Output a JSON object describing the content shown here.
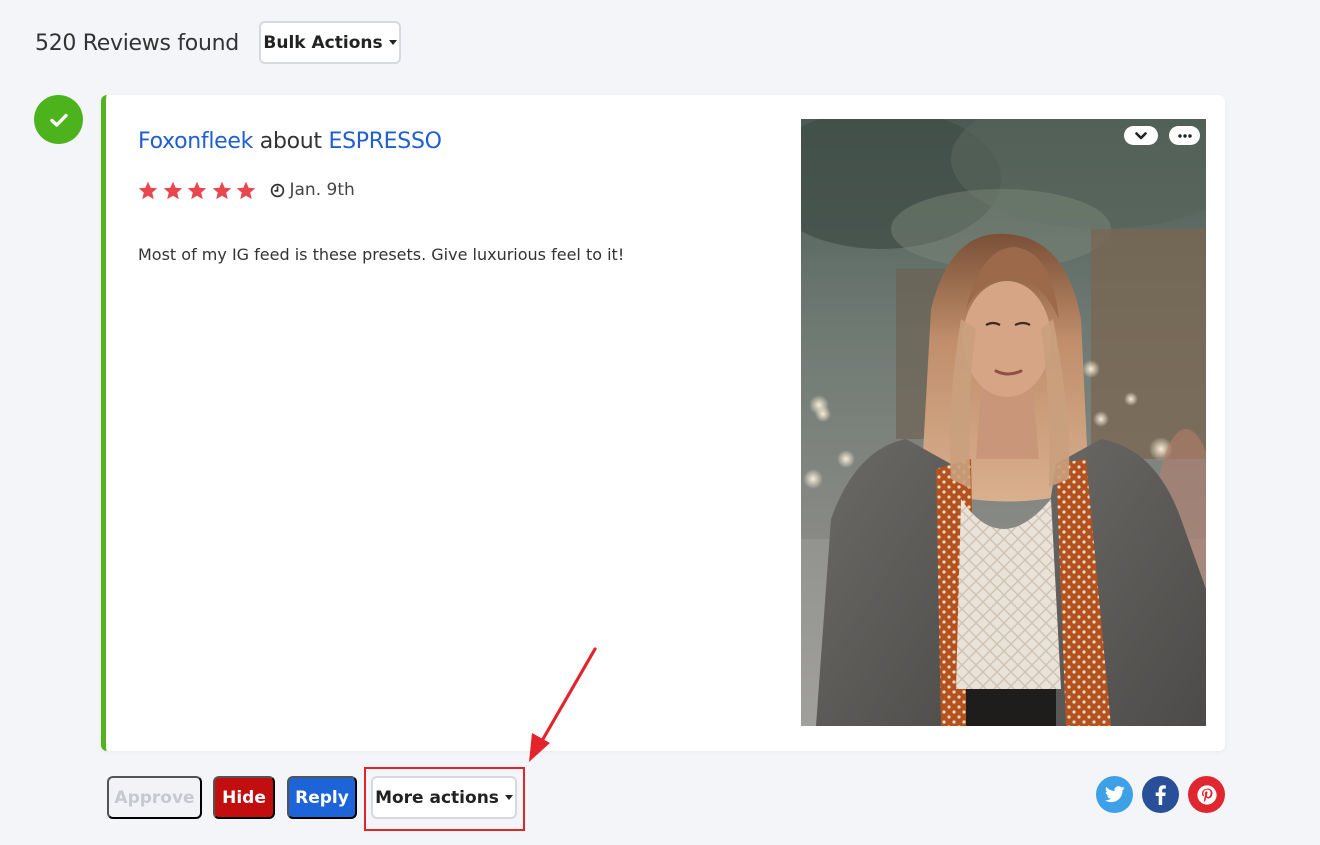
{
  "header": {
    "count_text": "520 Reviews found",
    "bulk_actions_label": "Bulk Actions"
  },
  "review": {
    "author": "Foxonfleek",
    "about_word": "about",
    "product": "ESPRESSO",
    "rating": 5,
    "rating_max": 5,
    "date": "Jan. 9th",
    "body": "Most of my IG feed is these presets. Give luxurious feel to it!",
    "status": "approved"
  },
  "actions": {
    "approve_label": "Approve",
    "hide_label": "Hide",
    "reply_label": "Reply",
    "more_actions_label": "More actions"
  },
  "social": {
    "twitter": "twitter-icon",
    "facebook": "facebook-icon",
    "pinterest": "pinterest-icon"
  },
  "colors": {
    "accent_green": "#52b21f",
    "link_blue": "#1f5fd1",
    "star_red": "#e8474f",
    "hide_red": "#c20e0e",
    "reply_blue": "#1c64d8",
    "highlight_red": "#e3242b"
  }
}
